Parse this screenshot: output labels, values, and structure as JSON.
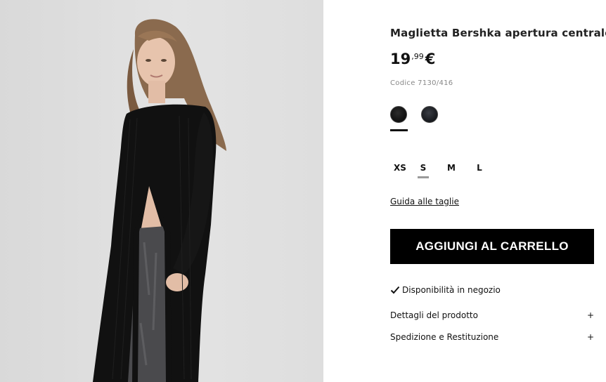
{
  "product": {
    "title": "Maglietta Bershka apertura centrale",
    "price_int": "19",
    "price_dec": ",99",
    "currency": "€",
    "code": "Codice 7130/416"
  },
  "colors": [
    {
      "name": "black",
      "hex": "#1a1a1a",
      "selected": true
    },
    {
      "name": "dark-navy",
      "hex": "#23262c",
      "selected": false
    }
  ],
  "sizes": [
    {
      "label": "XS",
      "selected": false
    },
    {
      "label": "S",
      "selected": true
    },
    {
      "label": "M",
      "selected": false
    },
    {
      "label": "L",
      "selected": false
    }
  ],
  "size_guide_label": "Guida alle taglie",
  "cart_button_label": "AGGIUNGI AL CARRELLO",
  "availability_label": "Disponibilità in negozio",
  "accordion": [
    {
      "label": "Dettagli del prodotto",
      "icon": "+"
    },
    {
      "label": "Spedizione e Restituzione",
      "icon": "+"
    }
  ],
  "theme": {
    "accent": "#000000",
    "muted": "#888888"
  }
}
